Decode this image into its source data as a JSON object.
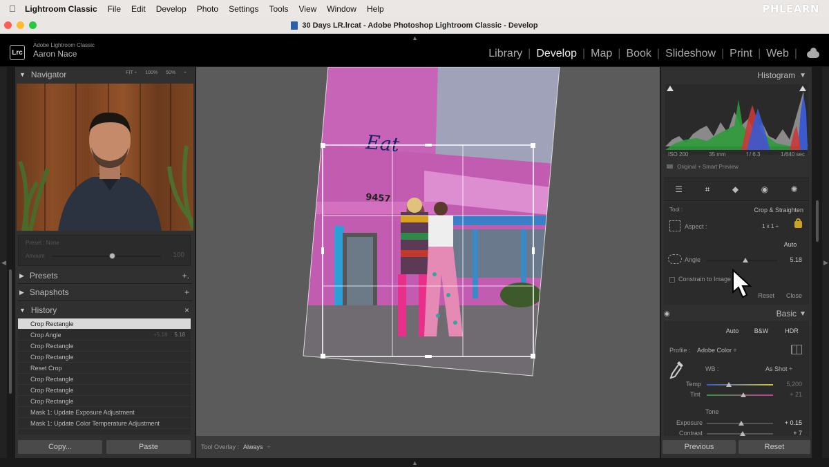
{
  "menubar": {
    "apple": "",
    "app": "Lightroom Classic",
    "items": [
      "File",
      "Edit",
      "Develop",
      "Photo",
      "Settings",
      "Tools",
      "View",
      "Window",
      "Help"
    ],
    "brand": "PHLEARN"
  },
  "window": {
    "title": "30 Days LR.lrcat - Adobe Photoshop Lightroom Classic - Develop"
  },
  "identity": {
    "badge": "Lrc",
    "product": "Adobe Lightroom Classic",
    "user": "Aaron Nace"
  },
  "modules": [
    "Library",
    "Develop",
    "Map",
    "Book",
    "Slideshow",
    "Print",
    "Web"
  ],
  "active_module": "Develop",
  "left": {
    "navigator": {
      "title": "Navigator",
      "fit": "FIT ÷",
      "z100": "100%",
      "z50": "50%",
      "more": "÷"
    },
    "preset": {
      "label": "Preset : None",
      "amount_label": "Amount",
      "amount_value": "100",
      "amount_level": 0.55
    },
    "presets": {
      "title": "Presets",
      "action": "+."
    },
    "snapshots": {
      "title": "Snapshots",
      "action": "+"
    },
    "history": {
      "title": "History",
      "action": "×",
      "items": [
        {
          "label": "Crop Rectangle",
          "delta": "",
          "value": ""
        },
        {
          "label": "Crop Angle",
          "delta": "+5.18",
          "value": "5.18"
        },
        {
          "label": "Crop Rectangle",
          "delta": "",
          "value": ""
        },
        {
          "label": "Crop Rectangle",
          "delta": "",
          "value": ""
        },
        {
          "label": "Reset Crop",
          "delta": "",
          "value": ""
        },
        {
          "label": "Crop Rectangle",
          "delta": "",
          "value": ""
        },
        {
          "label": "Crop Rectangle",
          "delta": "",
          "value": ""
        },
        {
          "label": "Crop Rectangle",
          "delta": "",
          "value": ""
        },
        {
          "label": "Mask 1: Update Exposure Adjustment",
          "delta": "",
          "value": ""
        },
        {
          "label": "Mask 1: Update Color Temperature Adjustment",
          "delta": "",
          "value": ""
        }
      ]
    },
    "copy_label": "Copy...",
    "paste_label": "Paste"
  },
  "photo": {
    "sign_text": "Eat",
    "number": "9457"
  },
  "toolbar": {
    "overlay_label": "Tool Overlay :",
    "overlay_value": "Always",
    "overlay_arrow": "÷"
  },
  "right": {
    "histogram": {
      "title": "Histogram",
      "iso": "ISO 200",
      "focal": "35 mm",
      "aperture": "f / 6.3",
      "shutter": "1/640 sec",
      "preview": "Original + Smart Preview"
    },
    "crop": {
      "tool_label": "Tool :",
      "tool_value": "Crop & Straighten",
      "aspect_label": "Aspect :",
      "aspect_value": "1 x 1 ÷",
      "auto": "Auto",
      "angle_label": "Angle",
      "angle_value": "5.18",
      "angle_level": 0.55,
      "constrain": "Constrain to Image",
      "reset": "Reset",
      "close": "Close"
    },
    "basic": {
      "title": "Basic",
      "auto": "Auto",
      "bw": "B&W",
      "hdr": "HDR",
      "profile_label": "Profile :",
      "profile_value": "Adobe Color ÷",
      "wb_label": "WB :",
      "wb_value": "As Shot ÷",
      "temp_label": "Temp",
      "temp_value": "5,200",
      "temp_level": 0.33,
      "tint_label": "Tint",
      "tint_value": "+ 21",
      "tint_level": 0.55,
      "tone_label": "Tone",
      "exposure_label": "Exposure",
      "exposure_value": "+ 0.15",
      "exposure_level": 0.52,
      "contrast_label": "Contrast",
      "contrast_value": "+ 7",
      "contrast_level": 0.54
    },
    "previous": "Previous",
    "reset": "Reset"
  },
  "colors": {
    "accent_lock": "#c9a227",
    "selected_row": "#d9d9d9"
  }
}
